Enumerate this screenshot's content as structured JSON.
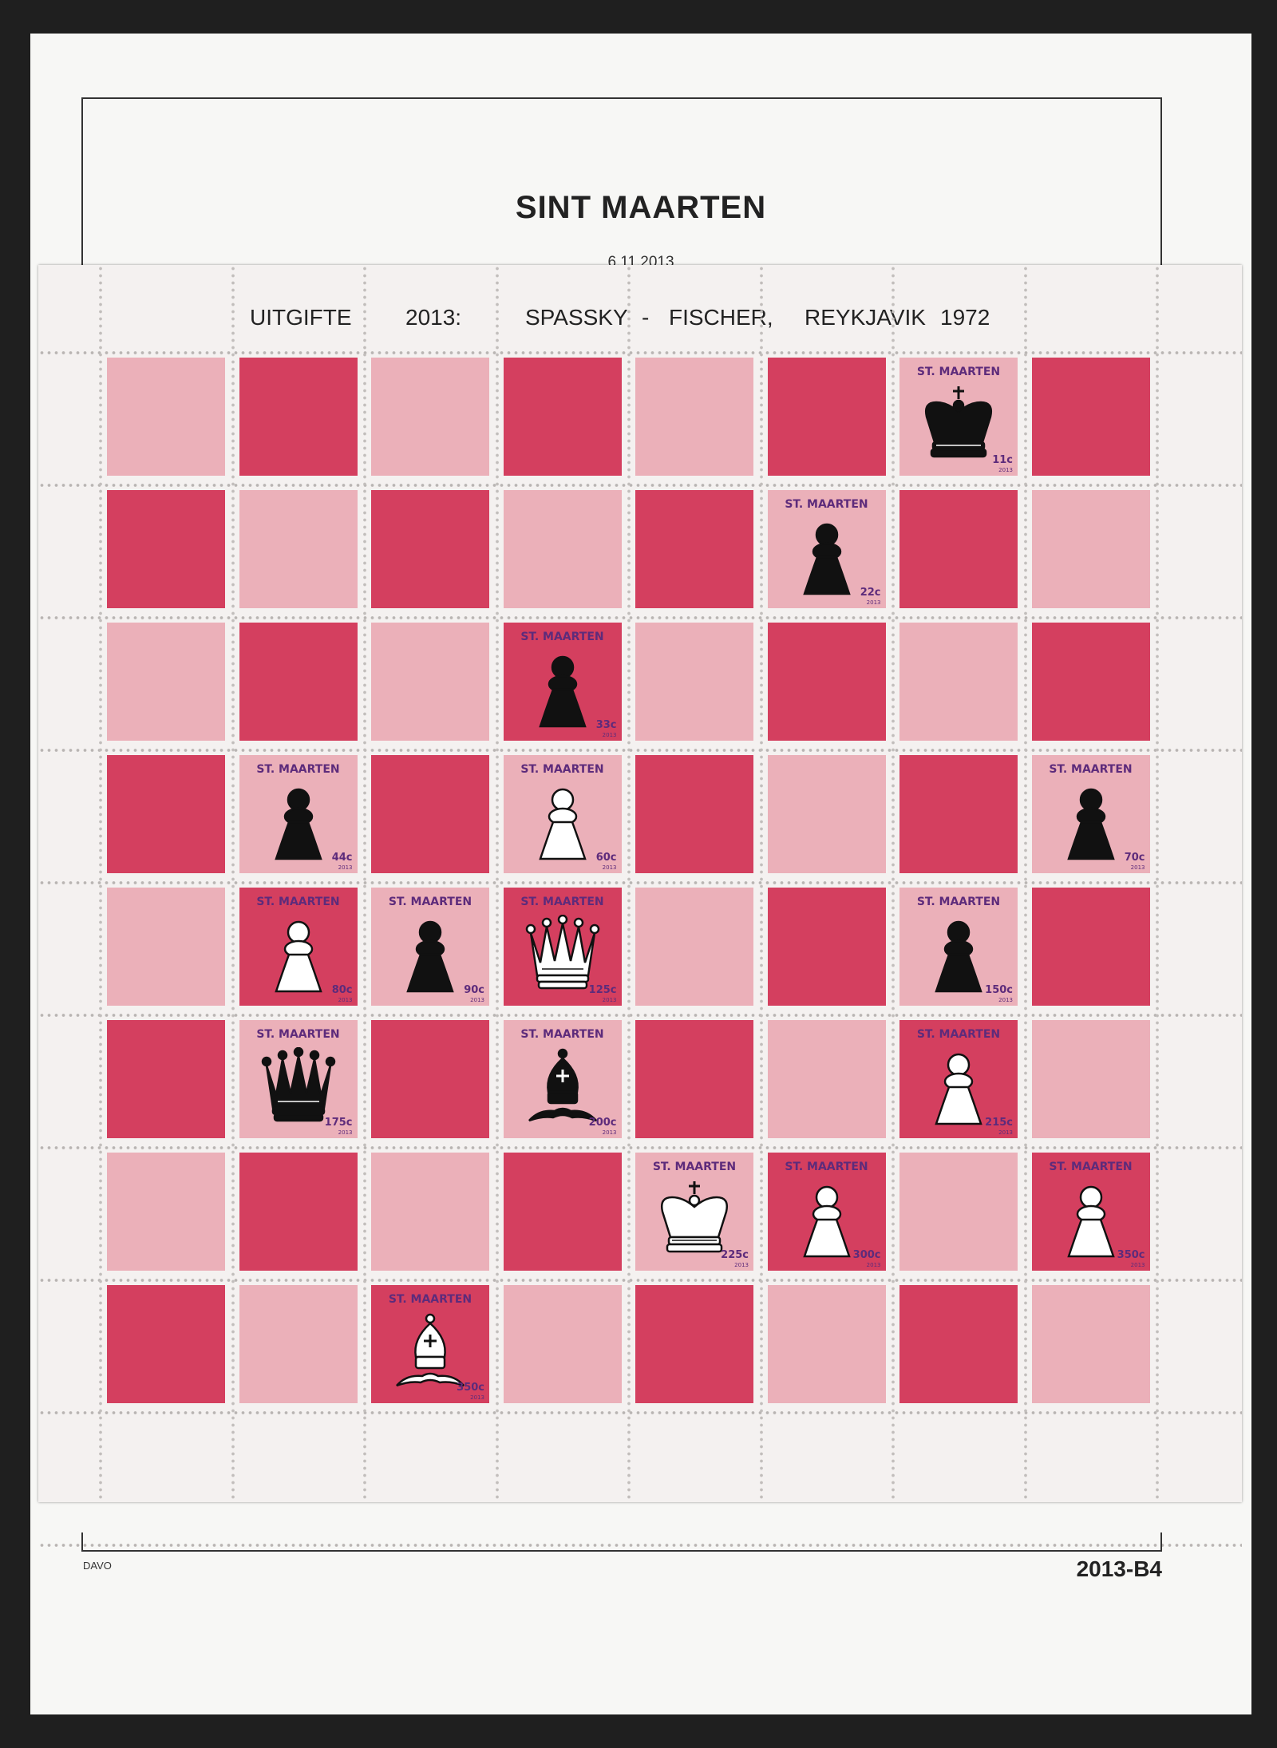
{
  "album": {
    "country": "SINT MAARTEN",
    "issue_date": "6.11.2013",
    "publisher": "DAVO",
    "page_number": "2013-B4"
  },
  "sheet": {
    "header_words": [
      "UITGIFTE",
      "2013:",
      "SPASSKY",
      "-",
      "FISCHER,",
      "REYKJAVIK",
      "1972"
    ],
    "colors": {
      "light": "#ebb0b9",
      "dark": "#d43f5f",
      "text": "#5d2b7b"
    },
    "stamp_name": "ST. MAARTEN",
    "stamp_year": "2013",
    "stamps": [
      {
        "row": 0,
        "col": 6,
        "piece": "king-icon",
        "color": "black",
        "value": "11c"
      },
      {
        "row": 1,
        "col": 5,
        "piece": "pawn-icon",
        "color": "black",
        "value": "22c"
      },
      {
        "row": 2,
        "col": 3,
        "piece": "pawn-icon",
        "color": "black",
        "value": "33c"
      },
      {
        "row": 3,
        "col": 1,
        "piece": "pawn-icon",
        "color": "black",
        "value": "44c"
      },
      {
        "row": 3,
        "col": 3,
        "piece": "pawn-icon",
        "color": "white",
        "value": "60c"
      },
      {
        "row": 3,
        "col": 7,
        "piece": "pawn-icon",
        "color": "black",
        "value": "70c"
      },
      {
        "row": 4,
        "col": 1,
        "piece": "pawn-icon",
        "color": "white",
        "value": "80c"
      },
      {
        "row": 4,
        "col": 2,
        "piece": "pawn-icon",
        "color": "black",
        "value": "90c"
      },
      {
        "row": 4,
        "col": 3,
        "piece": "queen-icon",
        "color": "white",
        "value": "125c"
      },
      {
        "row": 4,
        "col": 6,
        "piece": "pawn-icon",
        "color": "black",
        "value": "150c"
      },
      {
        "row": 5,
        "col": 1,
        "piece": "queen-icon",
        "color": "black",
        "value": "175c"
      },
      {
        "row": 5,
        "col": 3,
        "piece": "bishop-icon",
        "color": "black",
        "value": "200c"
      },
      {
        "row": 5,
        "col": 6,
        "piece": "pawn-icon",
        "color": "white",
        "value": "215c"
      },
      {
        "row": 6,
        "col": 4,
        "piece": "king-icon",
        "color": "white",
        "value": "225c"
      },
      {
        "row": 6,
        "col": 5,
        "piece": "pawn-icon",
        "color": "white",
        "value": "300c"
      },
      {
        "row": 6,
        "col": 7,
        "piece": "pawn-icon",
        "color": "white",
        "value": "350c"
      },
      {
        "row": 7,
        "col": 2,
        "piece": "bishop-icon",
        "color": "white",
        "value": "350c"
      }
    ]
  }
}
